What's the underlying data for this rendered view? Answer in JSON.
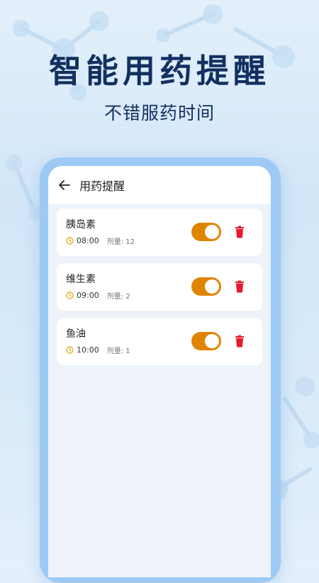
{
  "promo": {
    "headline": "智能用药提醒",
    "subline": "不错服药时间"
  },
  "app": {
    "title": "用药提醒",
    "back_icon": "arrow-left-icon"
  },
  "colors": {
    "accent_toggle": "#e08400",
    "delete_red": "#e8192c",
    "clock_orange": "#e0a000",
    "headline_navy": "#12305f"
  },
  "reminders": [
    {
      "name": "胰岛素",
      "time": "08:00",
      "dose": "剂量: 12",
      "enabled": true
    },
    {
      "name": "维生素",
      "time": "09:00",
      "dose": "剂量: 2",
      "enabled": true
    },
    {
      "name": "鱼油",
      "time": "10:00",
      "dose": "剂量: 1",
      "enabled": true
    }
  ]
}
